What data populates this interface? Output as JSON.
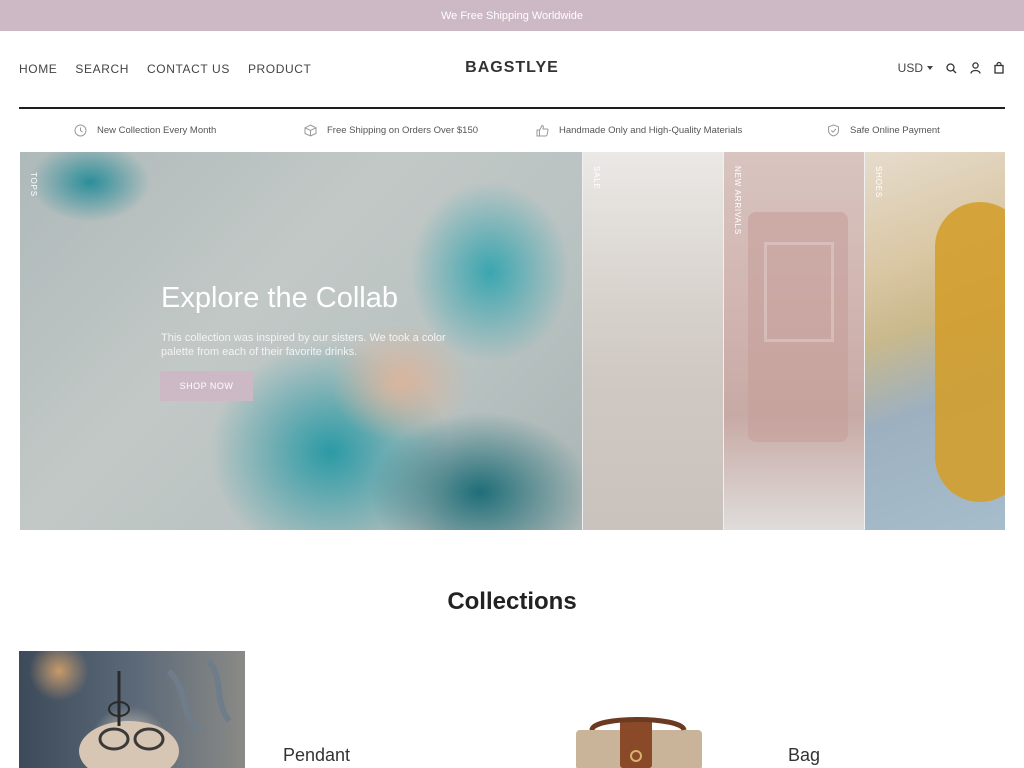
{
  "announcement": "We Free Shipping Worldwide",
  "header": {
    "nav": [
      "HOME",
      "SEARCH",
      "CONTACT US",
      "PRODUCT"
    ],
    "logo": "BAGSTLYE",
    "currency": "USD",
    "icons": [
      "search-icon",
      "account-icon",
      "cart-icon"
    ]
  },
  "features": [
    {
      "icon": "clock-icon",
      "text": "New Collection Every Month"
    },
    {
      "icon": "box-icon",
      "text": "Free Shipping on Orders Over $150"
    },
    {
      "icon": "thumbs-up-icon",
      "text": "Handmade Only and High-Quality Materials"
    },
    {
      "icon": "shield-icon",
      "text": "Safe Online Payment"
    }
  ],
  "hero": {
    "main_label": "TOPS",
    "title": "Explore the Collab",
    "description": "This collection was inspired by our sisters. We took a color palette from each of their favorite drinks.",
    "button": "SHOP NOW",
    "panels": [
      "SALE",
      "NEW ARRIVALS",
      "SHOES"
    ]
  },
  "collections": {
    "title": "Collections",
    "items": [
      "Pendant",
      "Bag"
    ]
  },
  "colors": {
    "accent": "#cdb9c5",
    "divider": "#1e1e1e"
  }
}
